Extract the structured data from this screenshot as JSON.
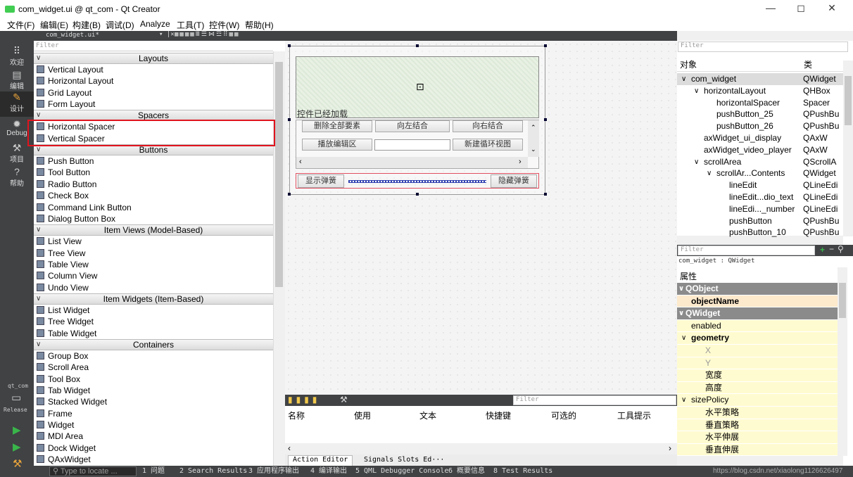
{
  "window": {
    "title": "com_widget.ui @ qt_com - Qt Creator",
    "minimize": "—",
    "restore": "◻",
    "close": "✕"
  },
  "menu": [
    "文件(F)",
    "编辑(E)",
    "构建(B)",
    "调试(D)",
    "Analyze",
    "工具(T)",
    "控件(W)",
    "帮助(H)"
  ],
  "modes": [
    {
      "label": "欢迎",
      "icon": "grid-icon"
    },
    {
      "label": "编辑",
      "icon": "edit-icon"
    },
    {
      "label": "设计",
      "icon": "design-pen-icon"
    },
    {
      "label": "Debug",
      "icon": "bug-icon"
    },
    {
      "label": "项目",
      "icon": "wrench-icon"
    },
    {
      "label": "帮助",
      "icon": "help-icon"
    }
  ],
  "kit": {
    "project": "qt_com",
    "config": "Release"
  },
  "editor_tab": {
    "file": "com_widget.ui*"
  },
  "widgetbox": {
    "filter_placeholder": "Filter",
    "categories": [
      {
        "name": "Layouts",
        "items": [
          "Vertical Layout",
          "Horizontal Layout",
          "Grid Layout",
          "Form Layout"
        ]
      },
      {
        "name": "Spacers",
        "items": [
          "Horizontal Spacer",
          "Vertical Spacer"
        ]
      },
      {
        "name": "Buttons",
        "items": [
          "Push Button",
          "Tool Button",
          "Radio Button",
          "Check Box",
          "Command Link Button",
          "Dialog Button Box"
        ]
      },
      {
        "name": "Item Views (Model-Based)",
        "items": [
          "List View",
          "Tree View",
          "Table View",
          "Column View",
          "Undo View"
        ]
      },
      {
        "name": "Item Widgets (Item-Based)",
        "items": [
          "List Widget",
          "Tree Widget",
          "Table Widget"
        ]
      },
      {
        "name": "Containers",
        "items": [
          "Group Box",
          "Scroll Area",
          "Tool Box",
          "Tab Widget",
          "Stacked Widget",
          "Frame",
          "Widget",
          "MDI Area",
          "Dock Widget",
          "QAxWidget"
        ]
      }
    ]
  },
  "form": {
    "axwidget_label": "控件已经加载",
    "buttons_row1": [
      "删除全部要素",
      "向左结合",
      "向右结合"
    ],
    "buttons_row2": [
      "播放编辑区",
      "",
      "新建循环视图"
    ],
    "show_button": "显示弹簧",
    "hide_button": "隐藏弹簧"
  },
  "object_inspector": {
    "filter_placeholder": "Filter",
    "col_object": "对象",
    "col_class": "类",
    "rows": [
      {
        "indent": 0,
        "arrow": "∨",
        "name": "com_widget",
        "cls": "QWidget"
      },
      {
        "indent": 1,
        "arrow": "∨",
        "name": "horizontalLayout",
        "cls": "QHBox"
      },
      {
        "indent": 2,
        "arrow": "",
        "name": "horizontalSpacer",
        "cls": "Spacer"
      },
      {
        "indent": 2,
        "arrow": "",
        "name": "pushButton_25",
        "cls": "QPushBu"
      },
      {
        "indent": 2,
        "arrow": "",
        "name": "pushButton_26",
        "cls": "QPushBu"
      },
      {
        "indent": 1,
        "arrow": "",
        "name": "axWidget_ui_display",
        "cls": "QAxW"
      },
      {
        "indent": 1,
        "arrow": "",
        "name": "axWidget_video_player",
        "cls": "QAxW"
      },
      {
        "indent": 1,
        "arrow": "∨",
        "name": "scrollArea",
        "cls": "QScrollA"
      },
      {
        "indent": 2,
        "arrow": "∨",
        "name": "scrollAr...Contents",
        "cls": "QWidget"
      },
      {
        "indent": 3,
        "arrow": "",
        "name": "lineEdit",
        "cls": "QLineEdi"
      },
      {
        "indent": 3,
        "arrow": "",
        "name": "lineEdit...dio_text",
        "cls": "QLineEdi"
      },
      {
        "indent": 3,
        "arrow": "",
        "name": "lineEdi..._number",
        "cls": "QLineEdi"
      },
      {
        "indent": 3,
        "arrow": "",
        "name": "pushButton",
        "cls": "QPushBu"
      },
      {
        "indent": 3,
        "arrow": "",
        "name": "pushButton_10",
        "cls": "QPushBu"
      }
    ]
  },
  "property_editor": {
    "filter_placeholder": "Filter",
    "context": "com_widget : QWidget",
    "header": "属性",
    "rows": [
      {
        "type": "grp",
        "text": "QObject"
      },
      {
        "type": "pink",
        "text": "objectName"
      },
      {
        "type": "grp",
        "text": "QWidget"
      },
      {
        "type": "yel",
        "text": "enabled",
        "indent": 1
      },
      {
        "type": "yel",
        "text": "geometry",
        "indent": 1,
        "bold": true,
        "arrow": "∨"
      },
      {
        "type": "yel",
        "text": "X",
        "indent": 3,
        "muted": true
      },
      {
        "type": "yel",
        "text": "Y",
        "indent": 3,
        "muted": true
      },
      {
        "type": "yel",
        "text": "宽度",
        "indent": 3
      },
      {
        "type": "yel",
        "text": "高度",
        "indent": 3
      },
      {
        "type": "yel",
        "text": "sizePolicy",
        "indent": 1,
        "arrow": "∨"
      },
      {
        "type": "yel",
        "text": "水平策略",
        "indent": 3
      },
      {
        "type": "yel",
        "text": "垂直策略",
        "indent": 3
      },
      {
        "type": "yel",
        "text": "水平伸展",
        "indent": 3
      },
      {
        "type": "yel",
        "text": "垂直伸展",
        "indent": 3
      }
    ]
  },
  "action_editor": {
    "filter_placeholder": "Filter",
    "columns": [
      "名称",
      "使用",
      "文本",
      "快捷键",
      "可选的",
      "工具提示"
    ],
    "tabs": [
      "Action Editor",
      "Signals Slots Ed···"
    ]
  },
  "statusbar": {
    "locate_placeholder": "Type to locate ...",
    "items": [
      "1 问题",
      "2 Search Results",
      "3 应用程序输出",
      "4 编译输出",
      "5 QML Debugger Console",
      "6 概要信息",
      "8 Test Results"
    ],
    "watermark": "https://blog.csdn.net/xiaolong1126626497"
  },
  "colors": {
    "highlight": "#e0141e",
    "modebar": "#404244",
    "property_yellow": "#fffbd0"
  }
}
